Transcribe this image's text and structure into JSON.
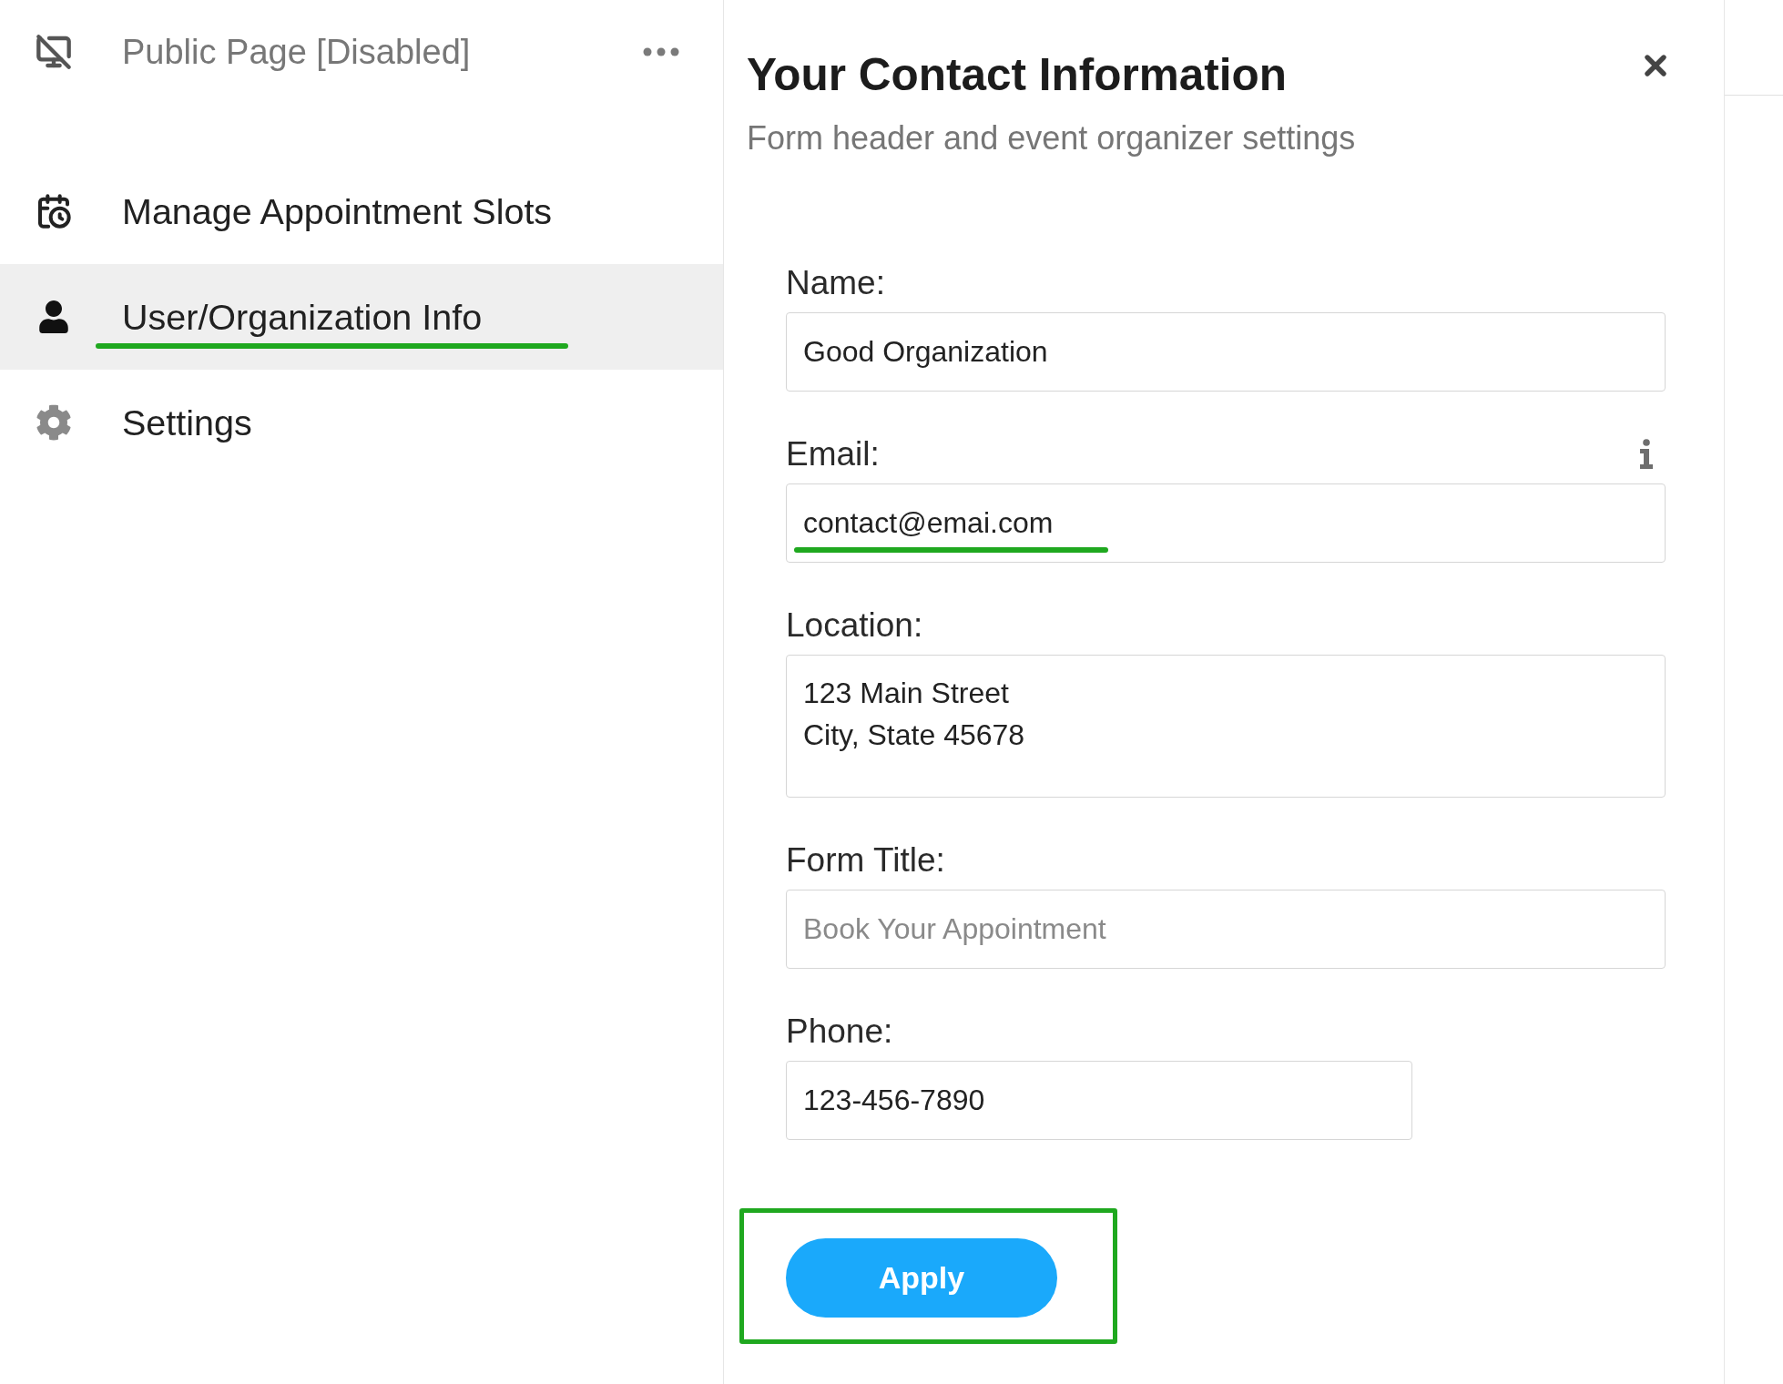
{
  "sidebar": {
    "header_item": {
      "label": "Public Page [Disabled]",
      "disabled": true
    },
    "items": [
      {
        "label": "Manage Appointment Slots",
        "selected": false,
        "marked": false
      },
      {
        "label": "User/Organization Info",
        "selected": true,
        "marked": true
      },
      {
        "label": "Settings",
        "selected": false,
        "marked": false
      }
    ]
  },
  "panel": {
    "title": "Your Contact Information",
    "subtitle": "Form header and event organizer settings"
  },
  "form": {
    "fields": [
      {
        "kind": "line",
        "label": "Name:",
        "value": "Good Organization",
        "info": false,
        "marked": false
      },
      {
        "kind": "line",
        "label": "Email:",
        "value": "contact@emai.com",
        "info": true,
        "marked": true
      },
      {
        "kind": "area",
        "label": "Location:",
        "value": "123 Main Street\nCity, State 45678",
        "info": false,
        "marked": false
      },
      {
        "kind": "line",
        "label": "Form Title:",
        "placeholder": "Book Your Appointment",
        "info": false,
        "marked": false
      },
      {
        "kind": "short",
        "label": "Phone:",
        "value": "123-456-7890",
        "info": false,
        "marked": false
      }
    ],
    "apply_button": {
      "label": "Apply",
      "marked": true
    }
  }
}
